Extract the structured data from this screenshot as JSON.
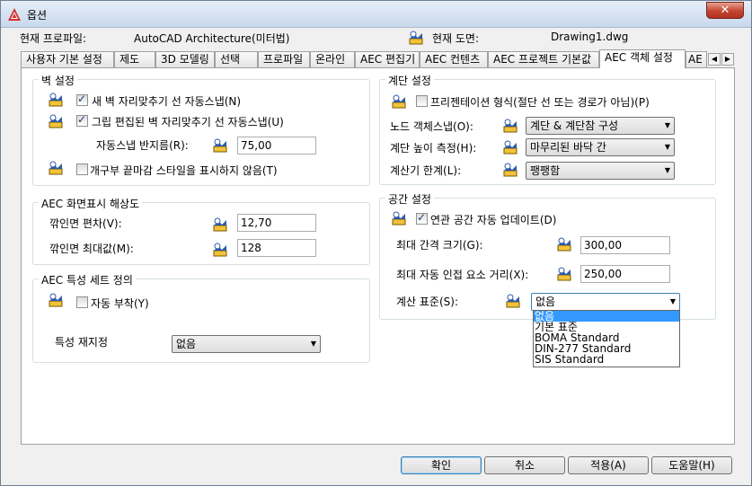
{
  "window": {
    "title": "옵션",
    "close_glyph": "✕"
  },
  "profile": {
    "current_profile_label": "현재 프로파일:",
    "current_profile_value": "AutoCAD Architecture(미터법)",
    "current_drawing_label": "현재 도면:",
    "current_drawing_value": "Drawing1.dwg"
  },
  "tabs": [
    "사용자 기본 설정",
    "제도",
    "3D 모델링",
    "선택",
    "프로파일",
    "온라인",
    "AEC 편집기",
    "AEC 컨텐츠",
    "AEC 프로젝트 기본값",
    "AEC 객체 설정",
    "AE"
  ],
  "active_tab": "AEC 객체 설정",
  "wall": {
    "title": "벽 설정",
    "autosnap_new": "새 벽 자리맞추기 선 자동스냅(N)",
    "autosnap_grip": "그립 편집된 벽 자리맞추기 선 자동스냅(U)",
    "radius_label": "자동스냅 반지름(R):",
    "radius_value": "75,00",
    "no_endcap": "개구부 끝마감 스타일을 표시하지 않음(T)"
  },
  "display": {
    "title": "AEC 화면표시 해상도",
    "facet_dev_label": "깎인면 편차(V):",
    "facet_dev_value": "12,70",
    "facet_max_label": "깎인면 최대값(M):",
    "facet_max_value": "128"
  },
  "propset": {
    "title": "AEC 특성 세트 정의",
    "auto_attach": "자동 부착(Y)",
    "reassign_label": "특성 재지정",
    "reassign_value": "없음"
  },
  "stair": {
    "title": "계단 설정",
    "presentation": "프리젠테이션 형식(절단 선 또는 경로가 아님)(P)",
    "node_snap_label": "노드 객체스냅(O):",
    "node_snap_value": "계단 & 계단참 구성",
    "height_label": "계단 높이 측정(H):",
    "height_value": "마무리된 바닥 간",
    "calc_label": "계산기 한계(L):",
    "calc_value": "팽팽함"
  },
  "space": {
    "title": "공간 설정",
    "auto_update": "연관 공간 자동 업데이트(D)",
    "max_gap_label": "최대 간격 크기(G):",
    "max_gap_value": "300,00",
    "max_dist_label": "최대 자동 인접 요소 거리(X):",
    "max_dist_value": "250,00",
    "calc_std_label": "계산 표준(S):",
    "calc_std_value": "없음",
    "calc_std_options": [
      "없음",
      "기본 표준",
      "BOMA Standard",
      "DIN-277 Standard",
      "SIS Standard"
    ]
  },
  "buttons": {
    "ok": "확인",
    "cancel": "취소",
    "apply": "적용(A)",
    "help": "도움말(H)"
  },
  "colors": {
    "accent": "#3399ff",
    "titlebar": "#c8d8ec",
    "close": "#c4452f"
  },
  "icons": {
    "app": "autocad-logo-icon",
    "drawing_setting": "drawing-setting-icon"
  }
}
